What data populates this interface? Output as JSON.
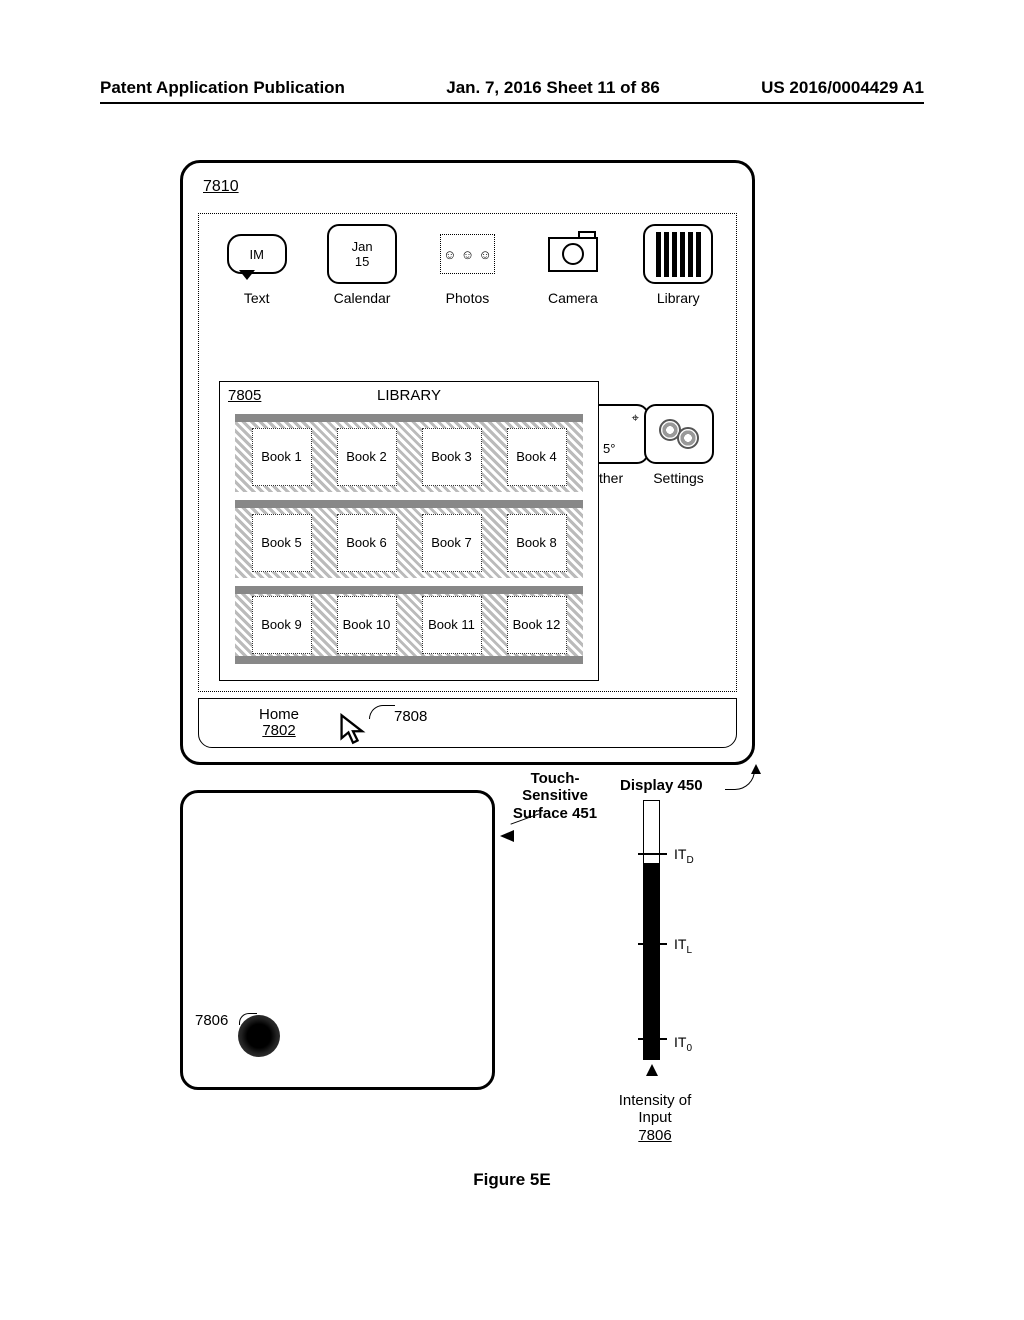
{
  "header": {
    "left": "Patent Application Publication",
    "center": "Jan. 7, 2016   Sheet 11 of 86",
    "right": "US 2016/0004429 A1"
  },
  "refs": {
    "r7810": "7810",
    "r7805": "7805",
    "r7808": "7808",
    "r7806_on_surface": "7806",
    "home": "Home",
    "home_num": "7802"
  },
  "apps_row1": [
    {
      "label": "Text",
      "icon": "im",
      "im_text": "IM"
    },
    {
      "label": "Calendar",
      "icon": "calendar",
      "cal_month": "Jan",
      "cal_day": "15"
    },
    {
      "label": "Photos",
      "icon": "photos"
    },
    {
      "label": "Camera",
      "icon": "camera"
    },
    {
      "label": "Library",
      "icon": "library"
    }
  ],
  "weather": {
    "label_partial": "ther",
    "temp_partial": "5°"
  },
  "settings": {
    "label": "Settings"
  },
  "library_popup": {
    "title": "LIBRARY",
    "shelves": [
      [
        "Book 1",
        "Book 2",
        "Book 3",
        "Book 4"
      ],
      [
        "Book 5",
        "Book 6",
        "Book 7",
        "Book 8"
      ],
      [
        "Book 9",
        "Book 10",
        "Book 11",
        "Book 12"
      ]
    ]
  },
  "labels": {
    "touch": "Touch-\nSensitive\nSurface 451",
    "display": "Display 450",
    "intensity": "Intensity of\nInput",
    "intensity_num": "7806",
    "it_d": "IT",
    "it_d_sub": "D",
    "it_l": "IT",
    "it_l_sub": "L",
    "it_0": "IT",
    "it_0_sub": "0"
  },
  "figure": "Figure 5E"
}
